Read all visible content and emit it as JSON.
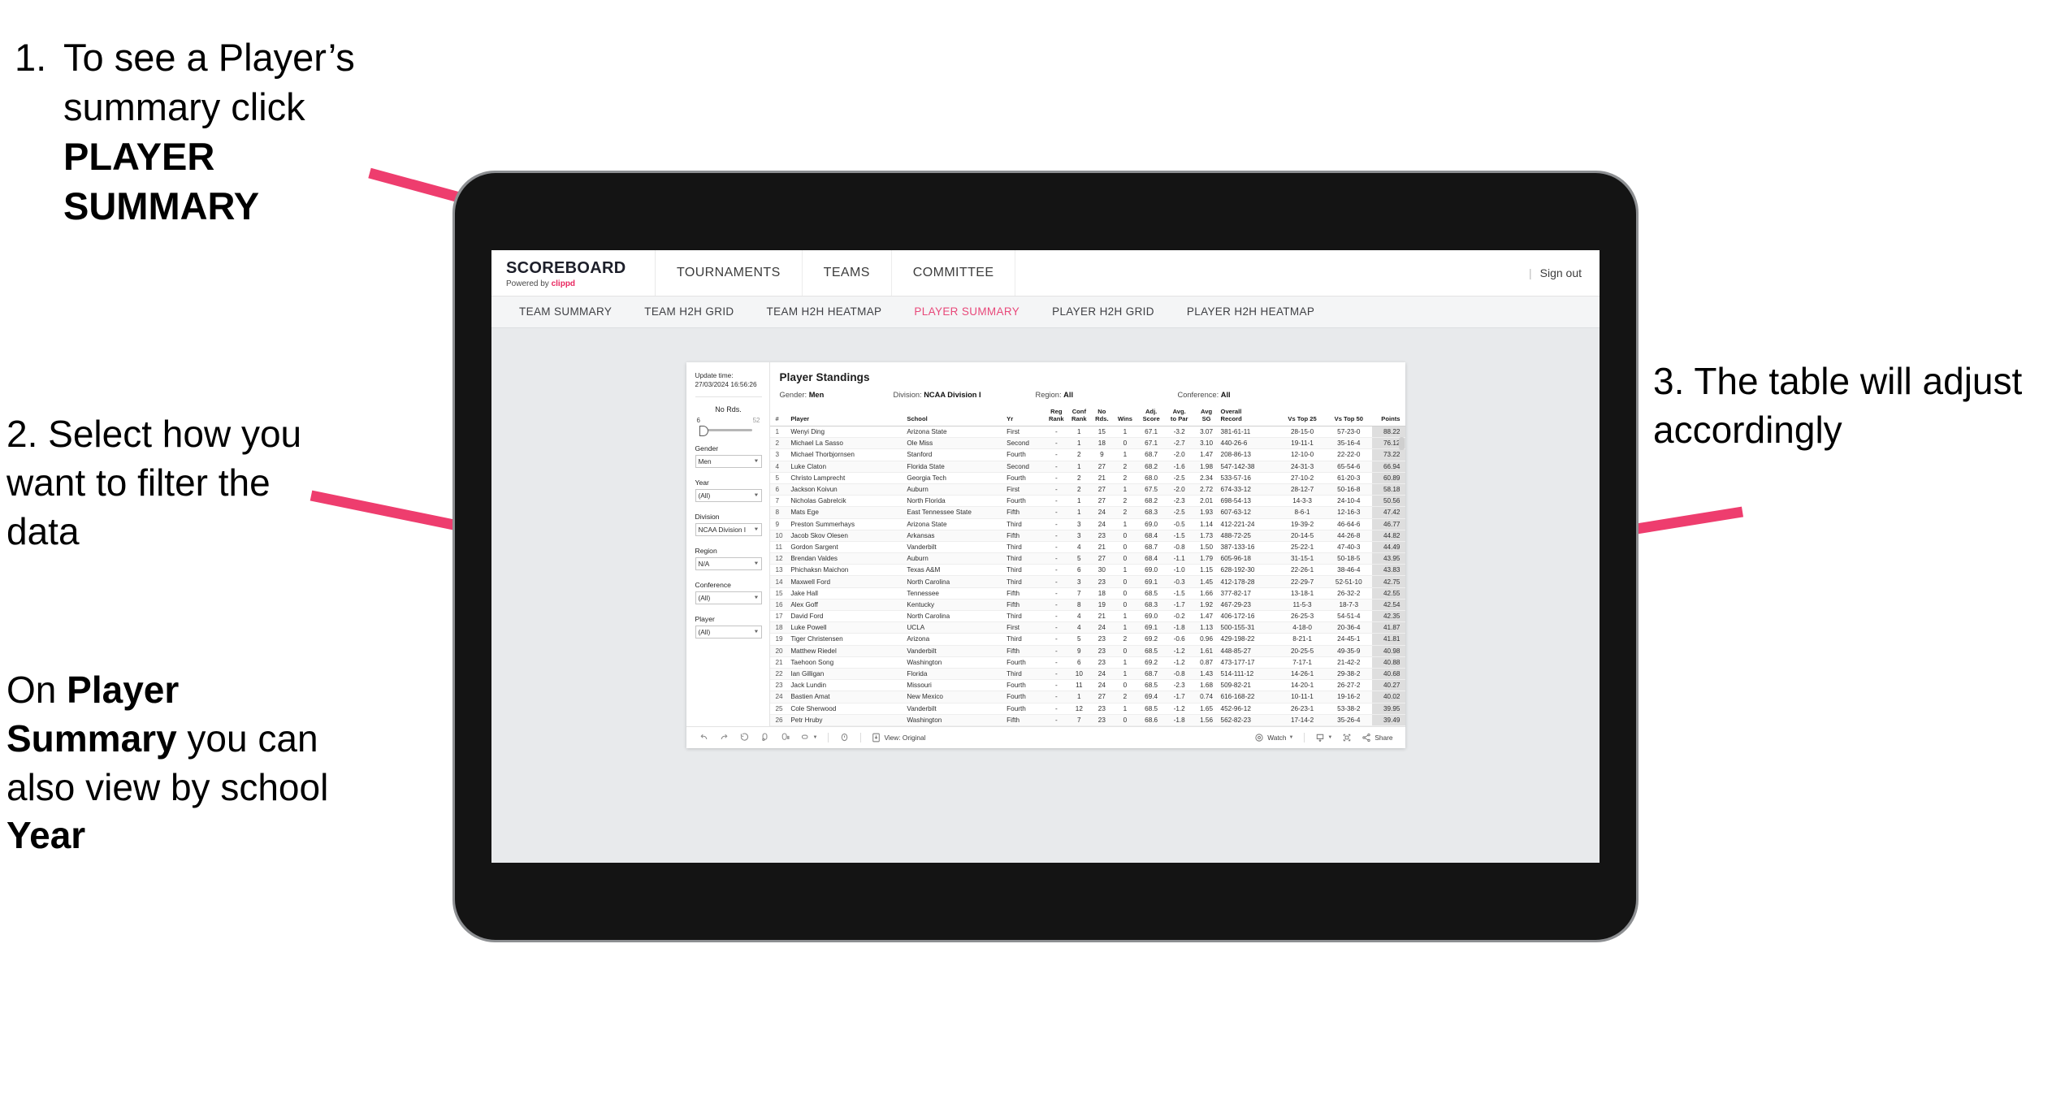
{
  "annotations": {
    "a1_num": "1.",
    "a1_line1": "To see a Player’s",
    "a1_line2": "summary click ",
    "a1_bold": "PLAYER SUMMARY",
    "a2": "2. Select how you want to filter the data",
    "a3_pre": "On ",
    "a3_b1": "Player Summary",
    "a3_mid": " you can also view by school ",
    "a3_b2": "Year",
    "a4": "3. The table will adjust accordingly"
  },
  "colors": {
    "accent_pink": "#e8497a",
    "arrow_pink": "#ee3d6e",
    "brand_red": "#e8275f",
    "app_bg": "#e8eaec"
  },
  "topbar": {
    "logo_main": "SCOREBOARD",
    "logo_sub_pre": "Powered by ",
    "logo_sub_brand": "clippd",
    "nav": [
      {
        "label": "TOURNAMENTS"
      },
      {
        "label": "TEAMS"
      },
      {
        "label": "COMMITTEE"
      }
    ],
    "sep": "|",
    "sign_out": "Sign out"
  },
  "subnav": {
    "tabs": [
      {
        "label": "TEAM SUMMARY",
        "active": false
      },
      {
        "label": "TEAM H2H GRID",
        "active": false
      },
      {
        "label": "TEAM H2H HEATMAP",
        "active": false
      },
      {
        "label": "PLAYER SUMMARY",
        "active": true
      },
      {
        "label": "PLAYER H2H GRID",
        "active": false
      },
      {
        "label": "PLAYER H2H HEATMAP",
        "active": false
      }
    ]
  },
  "filters": {
    "update_label": "Update time:",
    "update_value": "27/03/2024 16:56:26",
    "slider": {
      "label": "No Rds.",
      "min": "6",
      "max": "52"
    },
    "selects": [
      {
        "label": "Gender",
        "value": "Men"
      },
      {
        "label": "Year",
        "value": "(All)"
      },
      {
        "label": "Division",
        "value": "NCAA Division I"
      },
      {
        "label": "Region",
        "value": "N/A"
      },
      {
        "label": "Conference",
        "value": "(All)"
      },
      {
        "label": "Player",
        "value": "(All)"
      }
    ]
  },
  "sheet": {
    "title": "Player Standings",
    "subs": [
      {
        "label": "Gender: ",
        "value": "Men"
      },
      {
        "label": "Division: ",
        "value": "NCAA Division I"
      },
      {
        "label": "Region: ",
        "value": "All"
      },
      {
        "label": "Conference: ",
        "value": "All"
      }
    ]
  },
  "table": {
    "headers": [
      "#",
      "Player",
      "School",
      "Yr",
      "Reg Rank",
      "Conf Rank",
      "No Rds.",
      "Wins",
      "Adj. Score",
      "Avg. to Par",
      "Avg SG",
      "Overall Record",
      "Vs Top 25",
      "Vs Top 50",
      "Points"
    ],
    "headers_wrapped": [
      [
        "#",
        ""
      ],
      [
        "Player",
        ""
      ],
      [
        "School",
        ""
      ],
      [
        "Yr",
        ""
      ],
      [
        "Reg",
        "Rank"
      ],
      [
        "Conf",
        "Rank"
      ],
      [
        "No",
        "Rds."
      ],
      [
        "Wins",
        ""
      ],
      [
        "Adj.",
        "Score"
      ],
      [
        "Avg.",
        "to Par"
      ],
      [
        "Avg",
        "SG"
      ],
      [
        "Overall",
        "Record"
      ],
      [
        "Vs Top 25",
        ""
      ],
      [
        "Vs Top 50",
        ""
      ],
      [
        "Points",
        ""
      ]
    ],
    "rows": [
      [
        "1",
        "Wenyi Ding",
        "Arizona State",
        "First",
        "-",
        "1",
        "15",
        "1",
        "67.1",
        "-3.2",
        "3.07",
        "381-61-11",
        "28-15-0",
        "57-23-0",
        "88.22"
      ],
      [
        "2",
        "Michael La Sasso",
        "Ole Miss",
        "Second",
        "-",
        "1",
        "18",
        "0",
        "67.1",
        "-2.7",
        "3.10",
        "440-26-6",
        "19-11-1",
        "35-16-4",
        "76.12"
      ],
      [
        "3",
        "Michael Thorbjornsen",
        "Stanford",
        "Fourth",
        "-",
        "2",
        "9",
        "1",
        "68.7",
        "-2.0",
        "1.47",
        "208-86-13",
        "12-10-0",
        "22-22-0",
        "73.22"
      ],
      [
        "4",
        "Luke Claton",
        "Florida State",
        "Second",
        "-",
        "1",
        "27",
        "2",
        "68.2",
        "-1.6",
        "1.98",
        "547-142-38",
        "24-31-3",
        "65-54-6",
        "66.94"
      ],
      [
        "5",
        "Christo Lamprecht",
        "Georgia Tech",
        "Fourth",
        "-",
        "2",
        "21",
        "2",
        "68.0",
        "-2.5",
        "2.34",
        "533-57-16",
        "27-10-2",
        "61-20-3",
        "60.89"
      ],
      [
        "6",
        "Jackson Koivun",
        "Auburn",
        "First",
        "-",
        "2",
        "27",
        "1",
        "67.5",
        "-2.0",
        "2.72",
        "674-33-12",
        "28-12-7",
        "50-16-8",
        "58.18"
      ],
      [
        "7",
        "Nicholas Gabrelcik",
        "North Florida",
        "Fourth",
        "-",
        "1",
        "27",
        "2",
        "68.2",
        "-2.3",
        "2.01",
        "698-54-13",
        "14-3-3",
        "24-10-4",
        "50.56"
      ],
      [
        "8",
        "Mats Ege",
        "East Tennessee State",
        "Fifth",
        "-",
        "1",
        "24",
        "2",
        "68.3",
        "-2.5",
        "1.93",
        "607-63-12",
        "8-6-1",
        "12-16-3",
        "47.42"
      ],
      [
        "9",
        "Preston Summerhays",
        "Arizona State",
        "Third",
        "-",
        "3",
        "24",
        "1",
        "69.0",
        "-0.5",
        "1.14",
        "412-221-24",
        "19-39-2",
        "46-64-6",
        "46.77"
      ],
      [
        "10",
        "Jacob Skov Olesen",
        "Arkansas",
        "Fifth",
        "-",
        "3",
        "23",
        "0",
        "68.4",
        "-1.5",
        "1.73",
        "488-72-25",
        "20-14-5",
        "44-26-8",
        "44.82"
      ],
      [
        "11",
        "Gordon Sargent",
        "Vanderbilt",
        "Third",
        "-",
        "4",
        "21",
        "0",
        "68.7",
        "-0.8",
        "1.50",
        "387-133-16",
        "25-22-1",
        "47-40-3",
        "44.49"
      ],
      [
        "12",
        "Brendan Valdes",
        "Auburn",
        "Third",
        "-",
        "5",
        "27",
        "0",
        "68.4",
        "-1.1",
        "1.79",
        "605-96-18",
        "31-15-1",
        "50-18-5",
        "43.95"
      ],
      [
        "13",
        "Phichaksn Maichon",
        "Texas A&M",
        "Third",
        "-",
        "6",
        "30",
        "1",
        "69.0",
        "-1.0",
        "1.15",
        "628-192-30",
        "22-26-1",
        "38-46-4",
        "43.83"
      ],
      [
        "14",
        "Maxwell Ford",
        "North Carolina",
        "Third",
        "-",
        "3",
        "23",
        "0",
        "69.1",
        "-0.3",
        "1.45",
        "412-178-28",
        "22-29-7",
        "52-51-10",
        "42.75"
      ],
      [
        "15",
        "Jake Hall",
        "Tennessee",
        "Fifth",
        "-",
        "7",
        "18",
        "0",
        "68.5",
        "-1.5",
        "1.66",
        "377-82-17",
        "13-18-1",
        "26-32-2",
        "42.55"
      ],
      [
        "16",
        "Alex Goff",
        "Kentucky",
        "Fifth",
        "-",
        "8",
        "19",
        "0",
        "68.3",
        "-1.7",
        "1.92",
        "467-29-23",
        "11-5-3",
        "18-7-3",
        "42.54"
      ],
      [
        "17",
        "David Ford",
        "North Carolina",
        "Third",
        "-",
        "4",
        "21",
        "1",
        "69.0",
        "-0.2",
        "1.47",
        "406-172-16",
        "26-25-3",
        "54-51-4",
        "42.35"
      ],
      [
        "18",
        "Luke Powell",
        "UCLA",
        "First",
        "-",
        "4",
        "24",
        "1",
        "69.1",
        "-1.8",
        "1.13",
        "500-155-31",
        "4-18-0",
        "20-36-4",
        "41.87"
      ],
      [
        "19",
        "Tiger Christensen",
        "Arizona",
        "Third",
        "-",
        "5",
        "23",
        "2",
        "69.2",
        "-0.6",
        "0.96",
        "429-198-22",
        "8-21-1",
        "24-45-1",
        "41.81"
      ],
      [
        "20",
        "Matthew Riedel",
        "Vanderbilt",
        "Fifth",
        "-",
        "9",
        "23",
        "0",
        "68.5",
        "-1.2",
        "1.61",
        "448-85-27",
        "20-25-5",
        "49-35-9",
        "40.98"
      ],
      [
        "21",
        "Taehoon Song",
        "Washington",
        "Fourth",
        "-",
        "6",
        "23",
        "1",
        "69.2",
        "-1.2",
        "0.87",
        "473-177-17",
        "7-17-1",
        "21-42-2",
        "40.88"
      ],
      [
        "22",
        "Ian Gilligan",
        "Florida",
        "Third",
        "-",
        "10",
        "24",
        "1",
        "68.7",
        "-0.8",
        "1.43",
        "514-111-12",
        "14-26-1",
        "29-38-2",
        "40.68"
      ],
      [
        "23",
        "Jack Lundin",
        "Missouri",
        "Fourth",
        "-",
        "11",
        "24",
        "0",
        "68.5",
        "-2.3",
        "1.68",
        "509-82-21",
        "14-20-1",
        "26-27-2",
        "40.27"
      ],
      [
        "24",
        "Bastien Amat",
        "New Mexico",
        "Fourth",
        "-",
        "1",
        "27",
        "2",
        "69.4",
        "-1.7",
        "0.74",
        "616-168-22",
        "10-11-1",
        "19-16-2",
        "40.02"
      ],
      [
        "25",
        "Cole Sherwood",
        "Vanderbilt",
        "Fourth",
        "-",
        "12",
        "23",
        "1",
        "68.5",
        "-1.2",
        "1.65",
        "452-96-12",
        "26-23-1",
        "53-38-2",
        "39.95"
      ],
      [
        "26",
        "Petr Hruby",
        "Washington",
        "Fifth",
        "-",
        "7",
        "23",
        "0",
        "68.6",
        "-1.8",
        "1.56",
        "562-82-23",
        "17-14-2",
        "35-26-4",
        "39.49"
      ]
    ]
  },
  "toolbar": {
    "view_label": "View: Original",
    "watch_label": "Watch",
    "share_label": "Share",
    "icons": [
      "undo-icon",
      "redo-icon",
      "revert-icon",
      "refresh-icon",
      "pause-icon",
      "highlight-icon",
      "alert-icon"
    ]
  }
}
